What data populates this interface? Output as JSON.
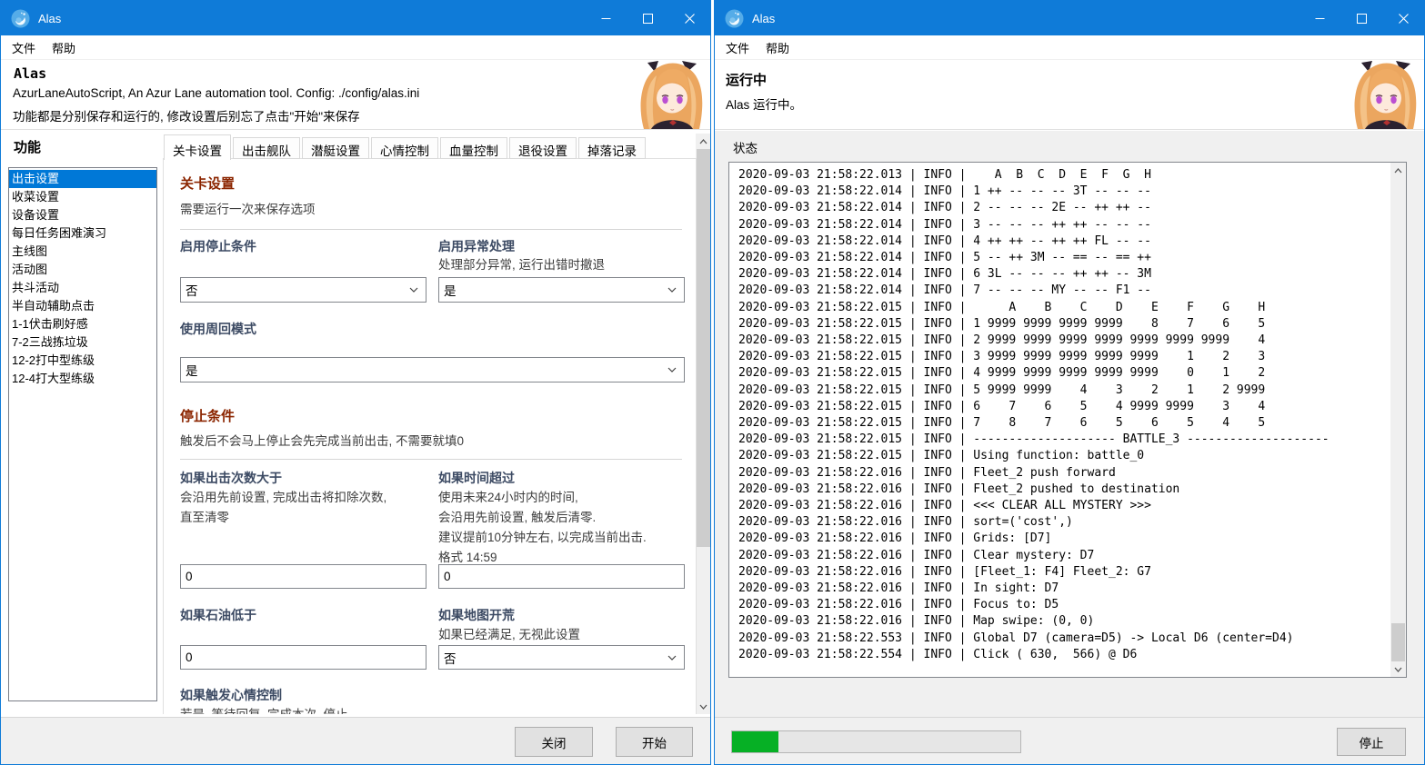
{
  "colors": {
    "titlebar_blue": "#0f7bd8",
    "selection_blue": "#0078d7",
    "section_red": "#8b2500",
    "label_navy": "#3c4a63",
    "progress_green": "#06b025"
  },
  "left": {
    "title": "Alas",
    "menu": [
      "文件",
      "帮助"
    ],
    "header": {
      "app_name": "Alas",
      "subtitle": "AzurLaneAutoScript, An Azur Lane automation tool. Config: ./config/alas.ini",
      "note": "功能都是分别保存和运行的, 修改设置后别忘了点击\"开始\"来保存"
    },
    "sidebar": {
      "label": "功能",
      "selected": "出击设置",
      "items": [
        "出击设置",
        "收菜设置",
        "设备设置",
        "每日任务困难演习",
        "主线图",
        "活动图",
        "共斗活动",
        "半自动辅助点击",
        "1-1伏击刷好感",
        "7-2三战拣垃圾",
        "12-2打中型练级",
        "12-4打大型练级"
      ]
    },
    "tabs": [
      "关卡设置",
      "出击舰队",
      "潜艇设置",
      "心情控制",
      "血量控制",
      "退役设置",
      "掉落记录"
    ],
    "active_tab": "关卡设置",
    "form": {
      "section1_title": "关卡设置",
      "section1_desc": "需要运行一次来保存选项",
      "enable_stop_label": "启用停止条件",
      "enable_stop_value": "否",
      "enable_exception_label": "启用异常处理",
      "enable_exception_desc": "处理部分异常, 运行出错时撤退",
      "enable_exception_value": "是",
      "loop_mode_label": "使用周回模式",
      "loop_mode_value": "是",
      "section2_title": "停止条件",
      "section2_desc": "触发后不会马上停止会先完成当前出击, 不需要就填0",
      "if_count_label": "如果出击次数大于",
      "if_count_desc": [
        "会沿用先前设置, 完成出击将扣除次数,",
        "直至清零"
      ],
      "if_count_value": "0",
      "if_time_label": "如果时间超过",
      "if_time_desc": [
        "使用未来24小时内的时间,",
        "会沿用先前设置, 触发后清零.",
        "建议提前10分钟左右, 以完成当前出击.",
        "格式 14:59"
      ],
      "if_time_value": "0",
      "if_oil_label": "如果石油低于",
      "if_oil_value": "0",
      "if_map_label": "如果地图开荒",
      "if_map_desc": "如果已经满足, 无视此设置",
      "if_map_value": "否",
      "if_emotion_label": "如果触发心情控制",
      "if_emotion_desc": "若是, 等待回复, 完成本次, 停止"
    },
    "footer": {
      "close": "关闭",
      "start": "开始"
    }
  },
  "right": {
    "title": "Alas",
    "menu": [
      "文件",
      "帮助"
    ],
    "header": {
      "status_title": "运行中",
      "status_text": "Alas 运行中。"
    },
    "status_label": "状态",
    "progress_percent": 16,
    "stop_button": "停止",
    "log_lines": [
      "2020-09-03 21:58:22.013 | INFO |    A  B  C  D  E  F  G  H",
      "2020-09-03 21:58:22.014 | INFO | 1 ++ -- -- -- 3T -- -- --",
      "2020-09-03 21:58:22.014 | INFO | 2 -- -- -- 2E -- ++ ++ --",
      "2020-09-03 21:58:22.014 | INFO | 3 -- -- -- ++ ++ -- -- --",
      "2020-09-03 21:58:22.014 | INFO | 4 ++ ++ -- ++ ++ FL -- --",
      "2020-09-03 21:58:22.014 | INFO | 5 -- ++ 3M -- == -- == ++",
      "2020-09-03 21:58:22.014 | INFO | 6 3L -- -- -- ++ ++ -- 3M",
      "2020-09-03 21:58:22.014 | INFO | 7 -- -- -- MY -- -- F1 --",
      "2020-09-03 21:58:22.015 | INFO |      A    B    C    D    E    F    G    H",
      "2020-09-03 21:58:22.015 | INFO | 1 9999 9999 9999 9999    8    7    6    5",
      "2020-09-03 21:58:22.015 | INFO | 2 9999 9999 9999 9999 9999 9999 9999    4",
      "2020-09-03 21:58:22.015 | INFO | 3 9999 9999 9999 9999 9999    1    2    3",
      "2020-09-03 21:58:22.015 | INFO | 4 9999 9999 9999 9999 9999    0    1    2",
      "2020-09-03 21:58:22.015 | INFO | 5 9999 9999    4    3    2    1    2 9999",
      "2020-09-03 21:58:22.015 | INFO | 6    7    6    5    4 9999 9999    3    4",
      "2020-09-03 21:58:22.015 | INFO | 7    8    7    6    5    6    5    4    5",
      "2020-09-03 21:58:22.015 | INFO | -------------------- BATTLE_3 --------------------",
      "2020-09-03 21:58:22.015 | INFO | Using function: battle_0",
      "2020-09-03 21:58:22.016 | INFO | Fleet_2 push forward",
      "2020-09-03 21:58:22.016 | INFO | Fleet_2 pushed to destination",
      "2020-09-03 21:58:22.016 | INFO | <<< CLEAR ALL MYSTERY >>>",
      "2020-09-03 21:58:22.016 | INFO | sort=('cost',)",
      "2020-09-03 21:58:22.016 | INFO | Grids: [D7]",
      "2020-09-03 21:58:22.016 | INFO | Clear mystery: D7",
      "2020-09-03 21:58:22.016 | INFO | [Fleet_1: F4] Fleet_2: G7",
      "2020-09-03 21:58:22.016 | INFO | In sight: D7",
      "2020-09-03 21:58:22.016 | INFO | Focus to: D5",
      "2020-09-03 21:58:22.016 | INFO | Map swipe: (0, 0)",
      "2020-09-03 21:58:22.553 | INFO | Global D7 (camera=D5) -> Local D6 (center=D4)",
      "2020-09-03 21:58:22.554 | INFO | Click ( 630,  566) @ D6"
    ]
  }
}
